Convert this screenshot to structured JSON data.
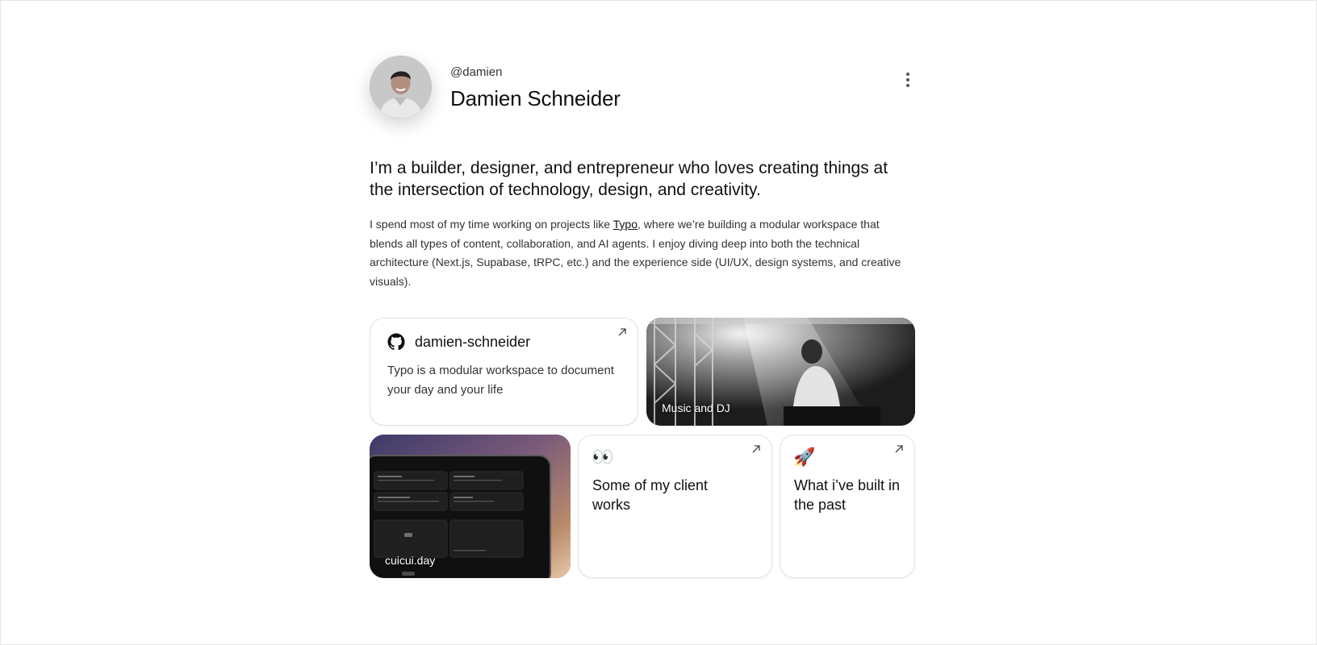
{
  "profile": {
    "handle": "@damien",
    "name": "Damien Schneider"
  },
  "headline": "I’m a builder, designer, and entrepreneur who loves creating things at the intersection of technology, design, and creativity.",
  "bio": {
    "before_link": "I spend most of my time working on projects like ",
    "link_text": "Typo",
    "after_link": ", where we’re building a modular workspace that blends all types of content, collaboration, and AI agents. I enjoy diving deep into both the technical architecture (Next.js, Supabase, tRPC, etc.) and the experience side (UI/UX, design systems, and creative visuals)."
  },
  "cards": {
    "github": {
      "icon": "github-icon",
      "title": "damien-schneider",
      "description": "Typo is a modular workspace to document your day and your life"
    },
    "music": {
      "label": "Music and DJ"
    },
    "app": {
      "label": "cuicui.day"
    },
    "client": {
      "emoji": "👀",
      "title": "Some of my client works"
    },
    "built": {
      "emoji": "🚀",
      "title": "What i’ve built in the past"
    }
  },
  "colors": {
    "text": "#111111",
    "muted": "#333333",
    "border": "#e2e2e2"
  }
}
